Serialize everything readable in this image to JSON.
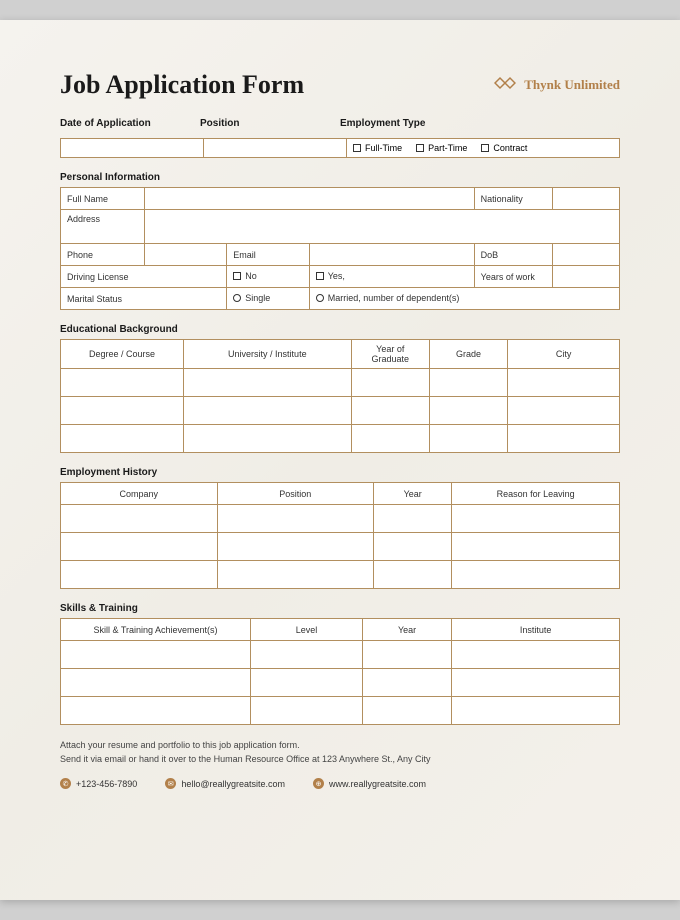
{
  "header": {
    "title": "Job Application Form",
    "brand": "Thynk Unlimited"
  },
  "top": {
    "date_label": "Date of Application",
    "position_label": "Position",
    "emp_type_label": "Employment Type",
    "opts": {
      "ft": "Full-Time",
      "pt": "Part-Time",
      "ct": "Contract"
    }
  },
  "personal": {
    "section": "Personal Information",
    "full_name": "Full Name",
    "nationality": "Nationality",
    "address": "Address",
    "phone": "Phone",
    "email": "Email",
    "dob": "DoB",
    "license": "Driving License",
    "no": "No",
    "yes": "Yes,",
    "years": "Years of work",
    "marital": "Marital Status",
    "single": "Single",
    "married": "Married, number of dependent(s)"
  },
  "edu": {
    "section": "Educational Background",
    "h1": "Degree / Course",
    "h2": "University / Institute",
    "h3": "Year of Graduate",
    "h4": "Grade",
    "h5": "City"
  },
  "emp": {
    "section": "Employment History",
    "h1": "Company",
    "h2": "Position",
    "h3": "Year",
    "h4": "Reason for Leaving"
  },
  "skills": {
    "section": "Skills & Training",
    "h1": "Skill & Training Achievement(s)",
    "h2": "Level",
    "h3": "Year",
    "h4": "Institute"
  },
  "footer": {
    "line1": "Attach your resume and portfolio to this job application form.",
    "line2": "Send it via email or hand it over to the Human Resource Office at 123 Anywhere St., Any City",
    "phone": "+123-456-7890",
    "email": "hello@reallygreatsite.com",
    "web": "www.reallygreatsite.com"
  }
}
